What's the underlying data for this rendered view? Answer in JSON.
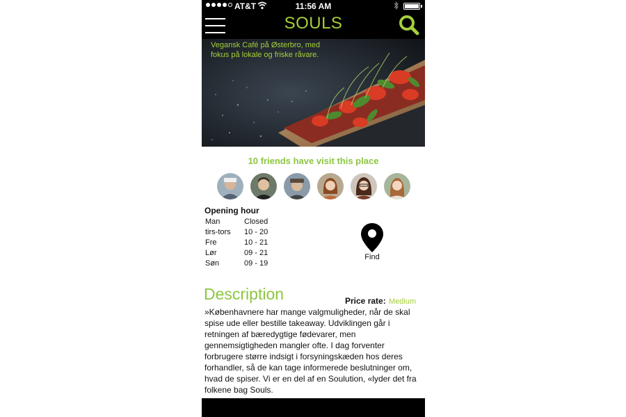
{
  "status_bar": {
    "carrier": "AT&T",
    "time": "11:56 AM",
    "signal_bars": 4,
    "battery_level": 1.0
  },
  "header": {
    "title": "SOULS",
    "menu_icon": "hamburger-menu-icon",
    "search_icon": "search-icon"
  },
  "hero": {
    "caption": "Vegansk Café på Østerbro, med fokus på lokale og friske råvare."
  },
  "friends": {
    "title": "10 friends have visit this place",
    "avatars": [
      "friend-1",
      "friend-2",
      "friend-3",
      "friend-4",
      "friend-5",
      "friend-6"
    ]
  },
  "opening_hours": {
    "title": "Opening hour",
    "rows": [
      {
        "day": "Man",
        "hours": "Closed"
      },
      {
        "day": "tirs-tors",
        "hours": "10 - 20"
      },
      {
        "day": "Fre",
        "hours": "10 - 21"
      },
      {
        "day": "Lør",
        "hours": "09 - 21"
      },
      {
        "day": "Søn",
        "hours": "09 - 19"
      }
    ]
  },
  "find": {
    "label": "Find",
    "icon": "map-pin-icon"
  },
  "description": {
    "title": "Description",
    "price_label": "Price rate:",
    "price_value": "Medium",
    "text": "»Københavnere har mange valgmuligheder, når de skal spise ude eller bestille takeaway. Udviklingen går i retningen af bæredygtige fødevarer, men gennemsigtigheden mangler ofte. I dag forventer forbrugere større indsigt i forsyningskæden hos deres forhandler, så de kan tage informerede beslutninger om, hvad de spiser. Vi er en del af en Soulution, «lyder det fra folkene bag Souls."
  },
  "colors": {
    "accent": "#a4cf3a",
    "header_bg": "#000000"
  }
}
